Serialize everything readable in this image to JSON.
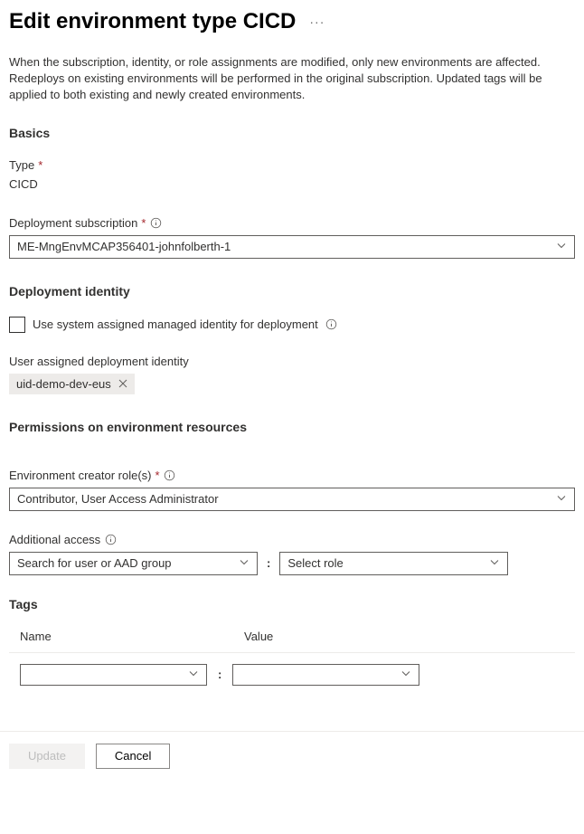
{
  "header": {
    "title": "Edit environment type CICD"
  },
  "description": "When the subscription, identity, or role assignments are modified, only new environments are affected. Redeploys on existing environments will be performed in the original subscription. Updated tags will be applied to both existing and newly created environments.",
  "basics": {
    "heading": "Basics",
    "type_label": "Type",
    "type_value": "CICD",
    "deployment_subscription_label": "Deployment subscription",
    "deployment_subscription_value": "ME-MngEnvMCAP356401-johnfolberth-1"
  },
  "identity": {
    "heading": "Deployment identity",
    "checkbox_label": "Use system assigned managed identity for deployment",
    "user_assigned_label": "User assigned deployment identity",
    "chip_value": "uid-demo-dev-eus"
  },
  "permissions": {
    "heading": "Permissions on environment resources",
    "creator_roles_label": "Environment creator role(s)",
    "creator_roles_value": "Contributor, User Access Administrator",
    "additional_access_label": "Additional access",
    "user_search_placeholder": "Search for user or AAD group",
    "role_placeholder": "Select role"
  },
  "tags": {
    "heading": "Tags",
    "name_header": "Name",
    "value_header": "Value"
  },
  "footer": {
    "update_label": "Update",
    "cancel_label": "Cancel"
  }
}
